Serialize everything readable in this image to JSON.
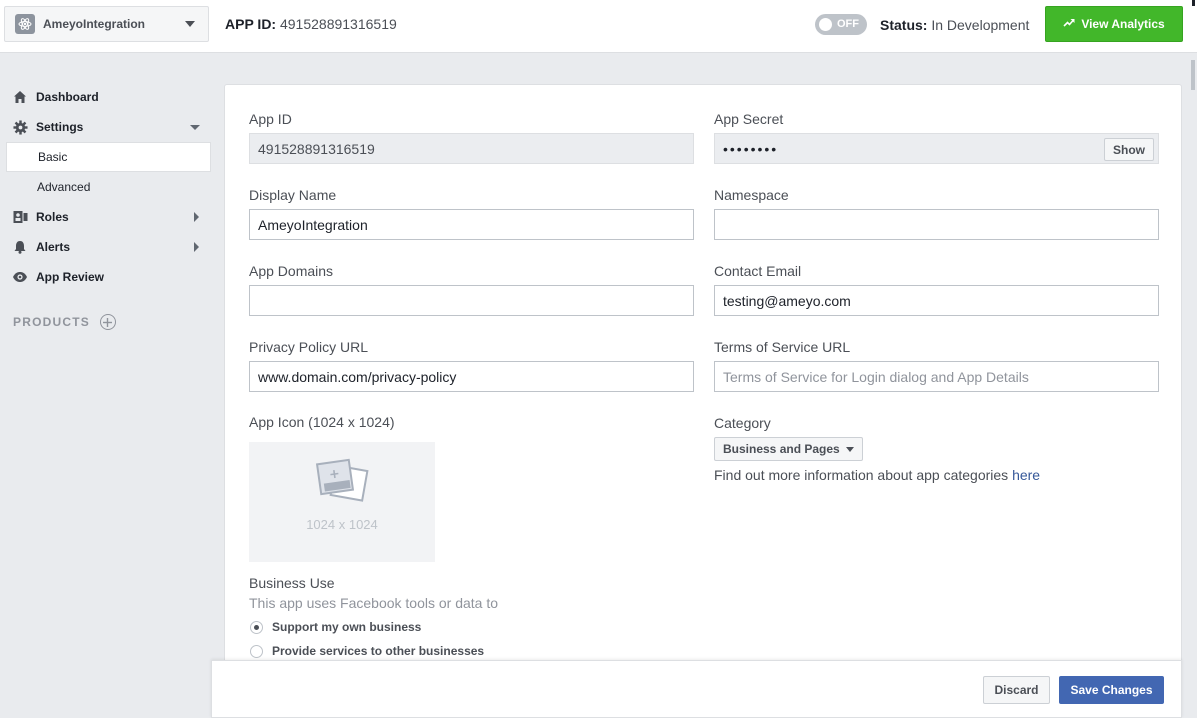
{
  "header": {
    "app_name": "AmeyoIntegration",
    "app_id_label": "APP ID:",
    "app_id_value": "491528891316519",
    "toggle_text": "OFF",
    "status_label": "Status:",
    "status_value": "In Development",
    "analytics_button": "View Analytics"
  },
  "sidebar": {
    "items": [
      {
        "label": "Dashboard",
        "icon": "home-icon"
      },
      {
        "label": "Settings",
        "icon": "gear-icon"
      },
      {
        "label": "Basic"
      },
      {
        "label": "Advanced"
      },
      {
        "label": "Roles",
        "icon": "roles-icon"
      },
      {
        "label": "Alerts",
        "icon": "bell-icon"
      },
      {
        "label": "App Review",
        "icon": "eye-icon"
      }
    ],
    "products_label": "PRODUCTS"
  },
  "form": {
    "app_id": {
      "label": "App ID",
      "value": "491528891316519"
    },
    "app_secret": {
      "label": "App Secret",
      "value": "••••••••",
      "show_button": "Show"
    },
    "display_name": {
      "label": "Display Name",
      "value": "AmeyoIntegration"
    },
    "namespace": {
      "label": "Namespace",
      "value": ""
    },
    "app_domains": {
      "label": "App Domains",
      "value": ""
    },
    "contact_email": {
      "label": "Contact Email",
      "value": "testing@ameyo.com"
    },
    "privacy_policy_url": {
      "label": "Privacy Policy URL",
      "value": "www.domain.com/privacy-policy"
    },
    "terms_url": {
      "label": "Terms of Service URL",
      "placeholder": "Terms of Service for Login dialog and App Details"
    },
    "app_icon": {
      "label": "App Icon (1024 x 1024)",
      "size_text": "1024 x 1024"
    },
    "category": {
      "label": "Category",
      "selected": "Business and Pages",
      "info_text": "Find out more information about app categories",
      "info_link": "here"
    },
    "business_use": {
      "label": "Business Use",
      "sub": "This app uses Facebook tools or data to",
      "options": [
        "Support my own business",
        "Provide services to other businesses"
      ],
      "selected_index": 0
    }
  },
  "footer": {
    "discard": "Discard",
    "save": "Save Changes"
  },
  "colors": {
    "accent_green": "#42b72a",
    "accent_blue": "#4267b2",
    "link": "#365899"
  }
}
